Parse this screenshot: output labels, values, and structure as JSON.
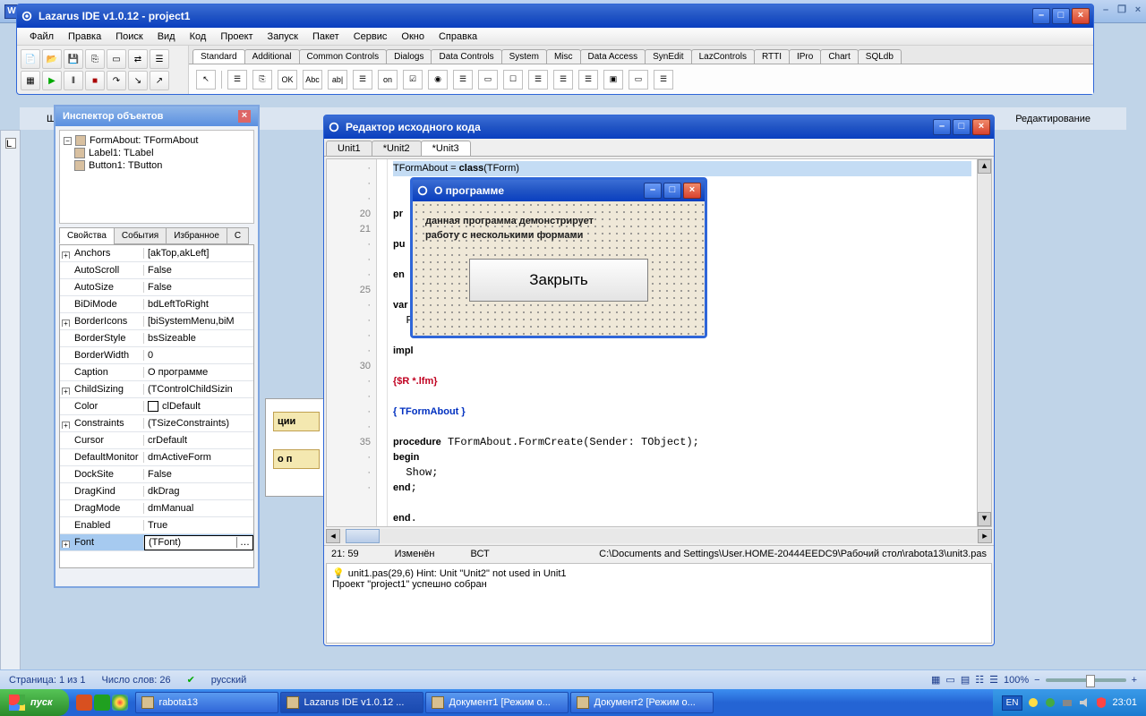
{
  "word": {
    "status_page": "Страница: 1 из 1",
    "status_words": "Число слов: 26",
    "status_lang": "русский",
    "zoom": "100%",
    "band_labels": [
      "Шрифт",
      "Редактирование"
    ]
  },
  "lazarus": {
    "title": "Lazarus IDE v1.0.12 - project1",
    "menu": [
      "Файл",
      "Правка",
      "Поиск",
      "Вид",
      "Код",
      "Проект",
      "Запуск",
      "Пакет",
      "Сервис",
      "Окно",
      "Справка"
    ],
    "comp_tabs": [
      "Standard",
      "Additional",
      "Common Controls",
      "Dialogs",
      "Data Controls",
      "System",
      "Misc",
      "Data Access",
      "SynEdit",
      "LazControls",
      "RTTI",
      "IPro",
      "Chart",
      "SQLdb"
    ],
    "palette_labels": [
      "☰",
      "⎘",
      "OK",
      "Abc",
      "ab|",
      "☰",
      "on",
      "☑",
      "◉",
      "☰",
      "▭",
      "☐",
      "☰",
      "☰",
      "☰",
      "▣",
      "▭",
      "☰"
    ]
  },
  "inspector": {
    "title": "Инспектор объектов",
    "tree": [
      {
        "label": "FormAbout: TFormAbout",
        "root": true
      },
      {
        "label": "Label1: TLabel"
      },
      {
        "label": "Button1: TButton"
      }
    ],
    "tabs": [
      "Свойства",
      "События",
      "Избранное",
      "С"
    ],
    "props": [
      {
        "k": "Anchors",
        "v": "[akTop,akLeft]",
        "exp": true
      },
      {
        "k": "AutoScroll",
        "v": "False"
      },
      {
        "k": "AutoSize",
        "v": "False"
      },
      {
        "k": "BiDiMode",
        "v": "bdLeftToRight"
      },
      {
        "k": "BorderIcons",
        "v": "[biSystemMenu,biM",
        "exp": true
      },
      {
        "k": "BorderStyle",
        "v": "bsSizeable"
      },
      {
        "k": "BorderWidth",
        "v": "0"
      },
      {
        "k": "Caption",
        "v": "О программе"
      },
      {
        "k": "ChildSizing",
        "v": "(TControlChildSizin",
        "exp": true
      },
      {
        "k": "Color",
        "v": "clDefault",
        "color": true
      },
      {
        "k": "Constraints",
        "v": "(TSizeConstraints)",
        "exp": true
      },
      {
        "k": "Cursor",
        "v": "crDefault"
      },
      {
        "k": "DefaultMonitor",
        "v": "dmActiveForm"
      },
      {
        "k": "DockSite",
        "v": "False"
      },
      {
        "k": "DragKind",
        "v": "dkDrag"
      },
      {
        "k": "DragMode",
        "v": "dmManual"
      },
      {
        "k": "Enabled",
        "v": "True"
      },
      {
        "k": "Font",
        "v": "(TFont)",
        "exp": true,
        "sel": true
      }
    ]
  },
  "editor": {
    "title": "Редактор исходного кода",
    "tabs": [
      "Unit1",
      "*Unit2",
      "*Unit3"
    ],
    "active_tab": 2,
    "gutter": [
      "·",
      "·",
      "·",
      "20",
      "21",
      "·",
      "·",
      "·",
      "25",
      "·",
      "·",
      "·",
      "·",
      "30",
      "·",
      "·",
      "·",
      "·",
      "35",
      "·",
      "·",
      "·"
    ],
    "code_lines": [
      {
        "html": "TFormAbout = <kw>class</kw>(TForm)",
        "cur": true
      },
      {
        "html": ""
      },
      {
        "html": "<kw>pr</kw>"
      },
      {
        "html": ""
      },
      {
        "html": "<kw>pu</kw>"
      },
      {
        "html": ""
      },
      {
        "html": "<kw>en</kw>"
      },
      {
        "html": ""
      },
      {
        "html": "<kw>var</kw>"
      },
      {
        "html": "  Fo"
      },
      {
        "html": ""
      },
      {
        "html": "<kw>impl</kw>"
      },
      {
        "html": ""
      },
      {
        "html": "<dir>{$R *.lfm}</dir>"
      },
      {
        "html": ""
      },
      {
        "html": "<cmt>{ TFormAbout }</cmt>"
      },
      {
        "html": ""
      },
      {
        "html": "<kw>procedure</kw> TFormAbout.FormCreate(Sender: TObject);"
      },
      {
        "html": "<kw>begin</kw>"
      },
      {
        "html": "  Show;"
      },
      {
        "html": "<kw>end</kw>;"
      },
      {
        "html": ""
      },
      {
        "html": "<kw>end</kw>."
      }
    ],
    "status": {
      "pos": "21: 59",
      "mod": "Изменён",
      "ins": "ВСТ",
      "path": "C:\\Documents and Settings\\User.HOME-20444EEDC9\\Рабочий стол\\rabota13\\unit3.pas"
    },
    "msg1": "unit1.pas(29,6) Hint: Unit \"Unit2\" not used in Unit1",
    "msg2": "Проект \"project1\" успешно собран"
  },
  "dialog": {
    "title": "О программе",
    "text1": "данная программа демонстрирует",
    "text2": "работу с несколькими формами",
    "close": "Закрыть"
  },
  "behind": {
    "label1": "ции",
    "label2": "о п"
  },
  "taskbar": {
    "start": "пуск",
    "tasks": [
      {
        "label": "rabota13"
      },
      {
        "label": "Lazarus IDE v1.0.12 ...",
        "act": true
      },
      {
        "label": "Документ1 [Режим о..."
      },
      {
        "label": "Документ2 [Режим о..."
      }
    ],
    "lang": "EN",
    "time": "23:01"
  }
}
